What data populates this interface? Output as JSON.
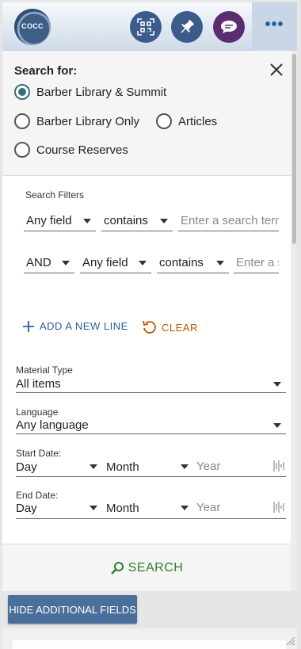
{
  "header": {
    "logo_text": "COCC",
    "icons": [
      "qr-code-icon",
      "pushpin-icon",
      "chat-icon"
    ],
    "more_label": "•••"
  },
  "scope": {
    "title": "Search for:",
    "options": [
      {
        "label": "Barber Library & Summit",
        "selected": true
      },
      {
        "label": "Barber Library Only",
        "selected": false
      },
      {
        "label": "Articles",
        "selected": false
      },
      {
        "label": "Course Reserves",
        "selected": false
      }
    ]
  },
  "filters": {
    "label": "Search Filters",
    "row1": {
      "field": "Any field",
      "operator": "contains",
      "placeholder": "Enter a search term"
    },
    "row2": {
      "boolean": "AND",
      "field": "Any field",
      "operator": "contains",
      "placeholder": "Enter a search term"
    }
  },
  "actions": {
    "add_line": "ADD A NEW LINE",
    "clear": "CLEAR"
  },
  "material_type": {
    "label": "Material Type",
    "value": "All items"
  },
  "language": {
    "label": "Language",
    "value": "Any language"
  },
  "start_date": {
    "label": "Start Date:",
    "day": "Day",
    "month": "Month",
    "year": "Year"
  },
  "end_date": {
    "label": "End Date:",
    "day": "Day",
    "month": "Month",
    "year": "Year"
  },
  "search_button": "SEARCH",
  "hide_button": "HIDE ADDITIONAL FIELDS",
  "colors": {
    "primary": "#2b5d9c",
    "clear": "#b35a00",
    "search": "#2e7d32",
    "radio": "#3b6e78",
    "chat": "#5b2c6f"
  }
}
